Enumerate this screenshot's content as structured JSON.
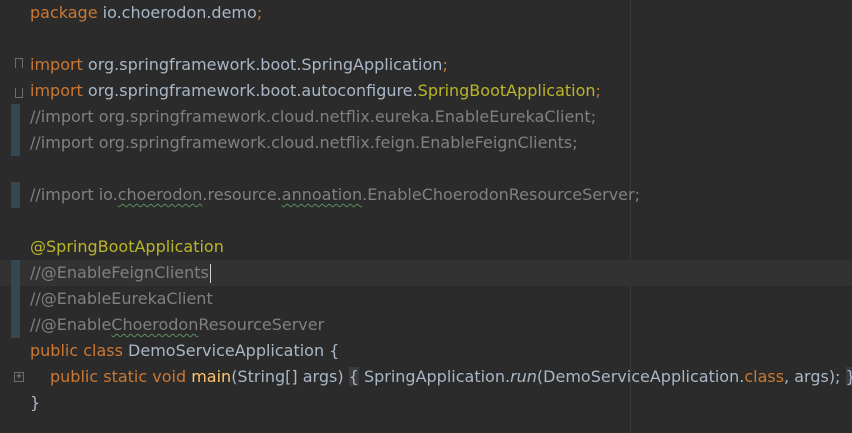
{
  "editor": {
    "language": "java",
    "colors": {
      "background": "#2b2b2b",
      "keyword": "#cc7832",
      "annotation": "#bbb529",
      "comment": "#808080",
      "method": "#ffc66d",
      "text": "#a9b7c6"
    },
    "lines": {
      "l1": {
        "kw": "package",
        "rest": " io.choerodon.demo",
        "semi": ";"
      },
      "l3": {
        "kw": "import",
        "rest": " org.springframework.boot.SpringApplication",
        "semi": ";"
      },
      "l4": {
        "kw": "import",
        "rest": " org.springframework.boot.autoconfigure.",
        "ann": "SpringBootApplication",
        "semi": ";"
      },
      "l5": {
        "text": "//import org.springframework.cloud.netflix.eureka.EnableEurekaClient;"
      },
      "l6": {
        "text": "//import org.springframework.cloud.netflix.feign.EnableFeignClients;"
      },
      "l8": {
        "p1": "//import io.",
        "w1": "choerodon",
        "p2": ".resource.",
        "w2": "annoation",
        "p3": ".EnableChoerodonResourceServer;"
      },
      "l10": {
        "text": "@SpringBootApplication"
      },
      "l11": {
        "text": "//@EnableFeignClients"
      },
      "l12": {
        "text": "//@EnableEurekaClient"
      },
      "l13": {
        "p1": "//@Enable",
        "w1": "Choerodon",
        "p2": "ResourceServer"
      },
      "l14": {
        "kw": "public class",
        "rest": " DemoServiceApplication {"
      },
      "l15": {
        "kw1": "public static void",
        "fn": "main",
        "params": "(String[] args) ",
        "open": "{",
        "call1": " SpringApplication.",
        "call2": "run",
        "call3": "(DemoServiceApplication.",
        "kw2": "class",
        "call4": ", args); ",
        "close": "}"
      },
      "l16": {
        "text": "}"
      }
    }
  }
}
